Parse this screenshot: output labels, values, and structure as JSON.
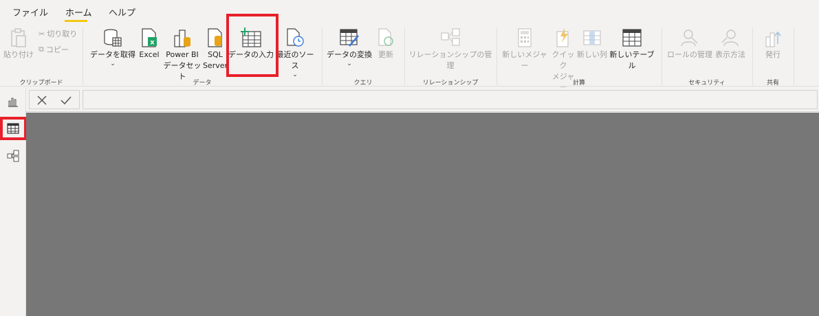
{
  "tabs": [
    {
      "label": "ファイル"
    },
    {
      "label": "ホーム",
      "active": true
    },
    {
      "label": "ヘルプ"
    }
  ],
  "clipboard": {
    "paste_label": "貼り付け",
    "cut_label": "切り取り",
    "copy_label": "コピー",
    "group_label": "クリップボード"
  },
  "data_group": {
    "get_data_label": "データを取得",
    "excel_label": "Excel",
    "powerbi_line1": "Power BI",
    "powerbi_line2": "データセット",
    "sql_line1": "SQL",
    "sql_line2": "Server",
    "enter_data_label": "データの入力",
    "recent_sources_label": "最近のソース",
    "group_label": "データ"
  },
  "query_group": {
    "transform_label": "データの変換",
    "refresh_label": "更新",
    "group_label": "クエリ"
  },
  "relationship_group": {
    "manage_label": "リレーションシップの管理",
    "group_label": "リレーションシップ"
  },
  "calc_group": {
    "new_measure_label": "新しいメジャー",
    "quick_line1": "クイック",
    "quick_line2": "メジャー",
    "new_column_label": "新しい列",
    "new_table_label": "新しいテーブル",
    "group_label": "計算"
  },
  "security_group": {
    "manage_roles_label": "ロールの管理",
    "view_as_label": "表示方法",
    "group_label": "セキュリティ"
  },
  "share_group": {
    "publish_label": "発行",
    "group_label": "共有"
  },
  "formula_bar": {
    "value": ""
  },
  "colors": {
    "accent": "#f2c811",
    "highlight": "#e8202a",
    "canvas": "#777777",
    "excel_green": "#21a366",
    "sql_yellow": "#e8a317"
  }
}
